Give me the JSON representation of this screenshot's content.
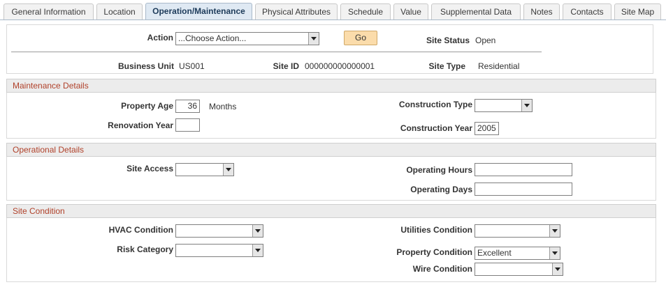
{
  "tabs": [
    {
      "label": "General Information",
      "active": false
    },
    {
      "label": "Location",
      "active": false
    },
    {
      "label": "Operation/Maintenance",
      "active": true
    },
    {
      "label": "Physical Attributes",
      "active": false
    },
    {
      "label": "Schedule",
      "active": false
    },
    {
      "label": "Value",
      "active": false
    },
    {
      "label": "Supplemental Data",
      "active": false
    },
    {
      "label": "Notes",
      "active": false
    },
    {
      "label": "Contacts",
      "active": false
    },
    {
      "label": "Site Map",
      "active": false
    }
  ],
  "header": {
    "action_label": "Action",
    "action_value": "...Choose Action...",
    "go_label": "Go",
    "site_status_label": "Site Status",
    "site_status_value": "Open",
    "business_unit_label": "Business Unit",
    "business_unit_value": "US001",
    "site_id_label": "Site ID",
    "site_id_value": "000000000000001",
    "site_type_label": "Site Type",
    "site_type_value": "Residential"
  },
  "maintenance": {
    "title": "Maintenance Details",
    "property_age_label": "Property Age",
    "property_age_value": "36",
    "property_age_unit": "Months",
    "renovation_year_label": "Renovation Year",
    "renovation_year_value": "",
    "construction_type_label": "Construction Type",
    "construction_type_value": "",
    "construction_year_label": "Construction Year",
    "construction_year_value": "2005"
  },
  "operational": {
    "title": "Operational Details",
    "site_access_label": "Site Access",
    "site_access_value": "",
    "operating_hours_label": "Operating Hours",
    "operating_hours_value": "",
    "operating_days_label": "Operating Days",
    "operating_days_value": ""
  },
  "condition": {
    "title": "Site Condition",
    "hvac_label": "HVAC Condition",
    "hvac_value": "",
    "risk_label": "Risk Category",
    "risk_value": "",
    "utilities_label": "Utilities Condition",
    "utilities_value": "",
    "property_label": "Property Condition",
    "property_value": "Excellent",
    "wire_label": "Wire Condition",
    "wire_value": ""
  }
}
